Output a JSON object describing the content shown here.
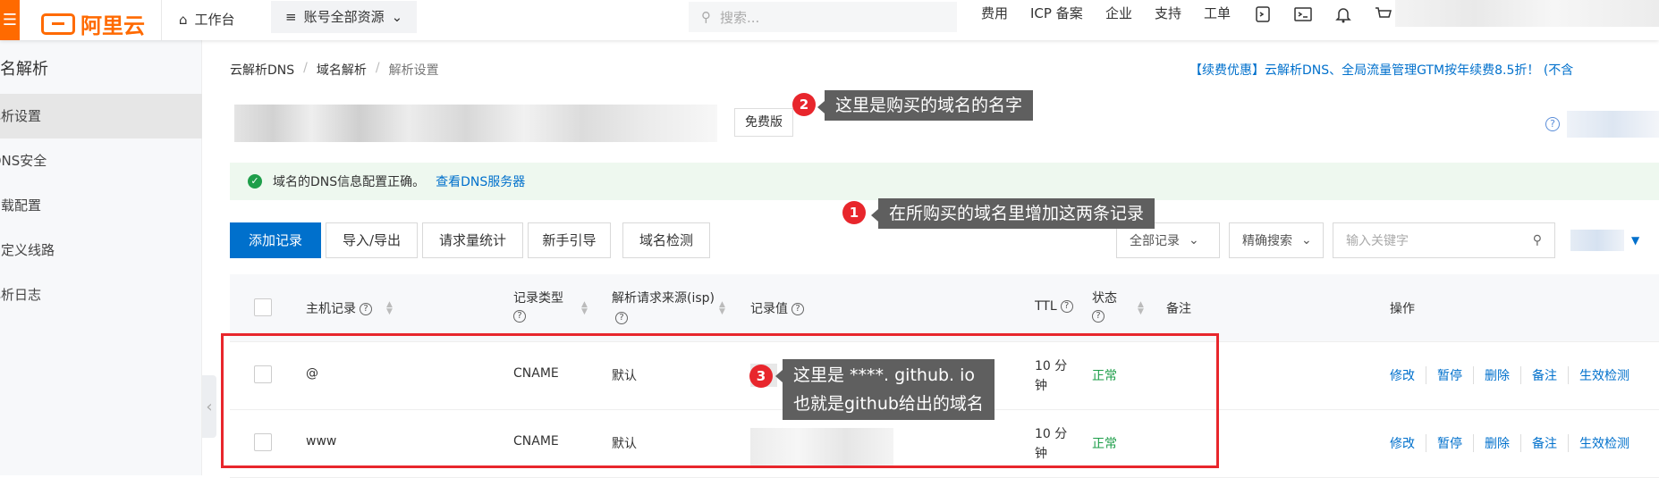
{
  "topbar": {
    "menu_icon": "☰",
    "logo_text": "阿里云",
    "workbench": "工作台",
    "account": "账号全部资源",
    "search_placeholder": "搜索...",
    "links": [
      "费用",
      "ICP 备案",
      "企业",
      "支持",
      "工单"
    ]
  },
  "sidebar": {
    "title": "域名解析",
    "items": [
      "解析设置",
      "DNS安全",
      "负载配置",
      "自定义线路",
      "解析日志"
    ]
  },
  "breadcrumb": [
    "云解析DNS",
    "域名解析",
    "解析设置"
  ],
  "promo": "【续费优惠】云解析DNS、全局流量管理GTM按年续费8.5折！ (不含",
  "free_badge": "免费版",
  "status_bar": {
    "text": "域名的DNS信息配置正确。",
    "link": "查看DNS服务器"
  },
  "toolbar": {
    "add": "添加记录",
    "import_export": "导入/导出",
    "req_stats": "请求量统计",
    "guide": "新手引导",
    "domain_check": "域名检测",
    "all_records": "全部记录",
    "exact_search": "精确搜索",
    "keyword_placeholder": "输入关键字"
  },
  "table": {
    "headers": {
      "host": "主机记录",
      "type": "记录类型",
      "source": "解析请求来源(isp)",
      "value": "记录值",
      "ttl": "TTL",
      "status": "状态",
      "remark": "备注",
      "ops": "操作"
    },
    "rows": [
      {
        "host": "@",
        "type": "CNAME",
        "source": "默认",
        "ttl": "10 分钟",
        "status": "正常"
      },
      {
        "host": "www",
        "type": "CNAME",
        "source": "默认",
        "ttl": "10 分钟",
        "status": "正常"
      }
    ],
    "ops": [
      "修改",
      "暂停",
      "删除",
      "备注",
      "生效检测"
    ]
  },
  "annotations": {
    "tip1_num": "1",
    "tip1": "在所购买的域名里增加这两条记录",
    "tip2_num": "2",
    "tip2": "这里是购买的域名的名字",
    "tip3_num": "3",
    "tip3_line1": "这里是 ****. github. io",
    "tip3_line2": "也就是github给出的域名"
  },
  "colors": {
    "brand_orange": "#ff6a00",
    "primary_blue": "#0070cc",
    "success_green": "#1e9e4a",
    "annotation_red": "#e8262c",
    "tooltip_grey": "#5f5f5f"
  }
}
